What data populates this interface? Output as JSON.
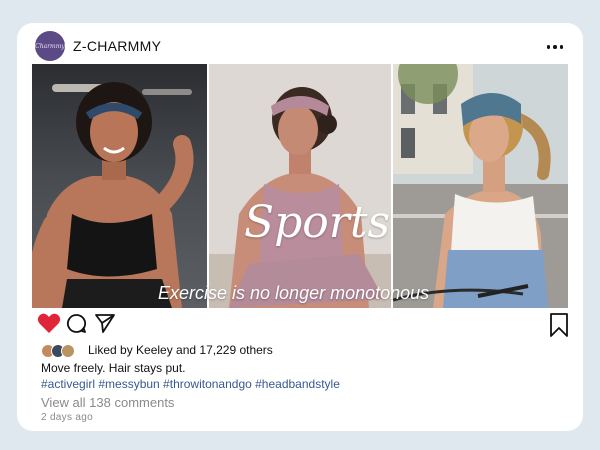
{
  "post": {
    "avatar_text": "Charmmy",
    "username": "Z-CHARMMY",
    "more_icon": "more-horizontal-icon",
    "overlay": {
      "title": "Sports",
      "subtitle": "Exercise is no longer monotonous"
    },
    "actions": {
      "like_icon": "heart-icon",
      "comment_icon": "comment-icon",
      "share_icon": "send-icon",
      "save_icon": "bookmark-icon",
      "like_color": "#e0243a"
    },
    "likes_text": "Liked by Keeley and 17,229 others",
    "caption": "Move freely. Hair stays put.",
    "hashtags": "#activegirl #messybun #throwitonandgo #headbandstyle",
    "view_comments": "View all 138 comments",
    "timestamp": "2 days ago"
  }
}
